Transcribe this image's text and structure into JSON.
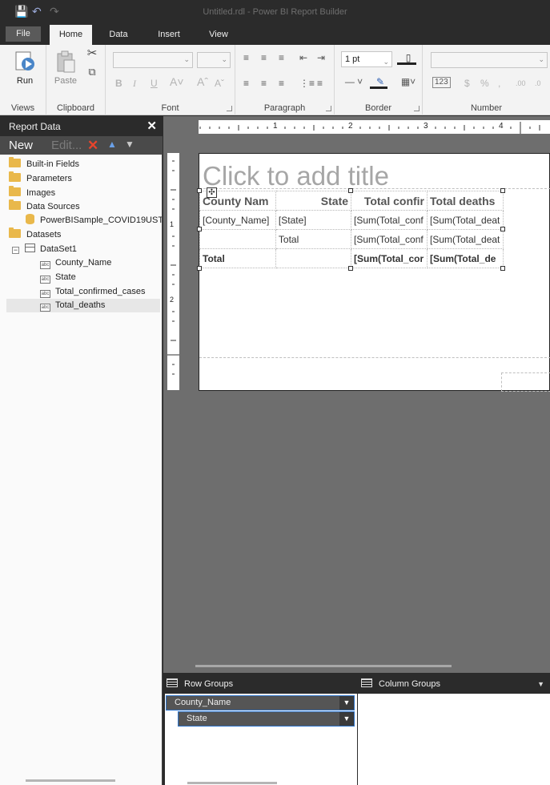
{
  "window": {
    "title": "Untitled.rdl - Power BI Report Builder"
  },
  "tabs": [
    "File",
    "Home",
    "Data",
    "Insert",
    "View"
  ],
  "ribbon": {
    "groups": {
      "views": "Views",
      "clipboard": "Clipboard",
      "font": "Font",
      "paragraph": "Paragraph",
      "border": "Border",
      "number": "Number"
    },
    "run_label": "Run",
    "paste_label": "Paste",
    "border_width": "1 pt",
    "number_format_placeholder": "123"
  },
  "report_data": {
    "title": "Report Data",
    "new_label": "New",
    "edit_label": "Edit...",
    "tree": {
      "builtin": "Built-in Fields",
      "parameters": "Parameters",
      "images": "Images",
      "datasources": "Data Sources",
      "datasource_item": "PowerBISample_COVID19USTr",
      "datasets": "Datasets",
      "dataset1": "DataSet1",
      "fields": [
        "County_Name",
        "State",
        "Total_confirmed_cases",
        "Total_deaths"
      ]
    }
  },
  "report": {
    "title_placeholder": "Click to add title",
    "tablix": {
      "headers": [
        "County Nam",
        "State",
        "Total confir",
        "Total deaths"
      ],
      "row1": [
        "[County_Name]",
        "[State]",
        "[Sum(Total_conf",
        "[Sum(Total_deat"
      ],
      "row2": [
        "",
        "Total",
        "[Sum(Total_conf",
        "[Sum(Total_deat"
      ],
      "row3": [
        "Total",
        "",
        "[Sum(Total_cor",
        "[Sum(Total_de"
      ]
    }
  },
  "ruler_marks": [
    "1",
    "2",
    "3",
    "4"
  ],
  "ruler_left_marks": [
    "1",
    "2"
  ],
  "groups": {
    "row_title": "Row Groups",
    "column_title": "Column Groups",
    "row_items": [
      "County_Name",
      "State"
    ]
  }
}
